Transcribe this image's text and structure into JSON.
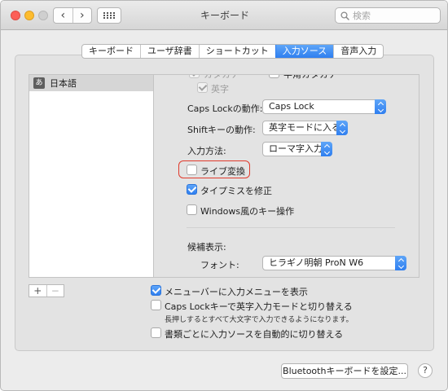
{
  "window": {
    "title": "キーボード"
  },
  "toolbar": {
    "back_glyph": "‹",
    "forward_glyph": "›",
    "show_all_icon": "grid-icon",
    "search_placeholder": "検索",
    "search_icon": "magnifier-icon"
  },
  "tabs": [
    {
      "label": "キーボード",
      "selected": false
    },
    {
      "label": "ユーザ辞書",
      "selected": false
    },
    {
      "label": "ショートカット",
      "selected": false
    },
    {
      "label": "入力ソース",
      "selected": true
    },
    {
      "label": "音声入力",
      "selected": false
    }
  ],
  "source_list": {
    "items": [
      {
        "icon_text": "あ",
        "label": "日本語",
        "selected": true
      }
    ],
    "add_label": "+",
    "remove_label": "−"
  },
  "input_source": {
    "partial_top": {
      "left_text": "カタカナ",
      "right_text": "半角カタカナ"
    },
    "eiji": {
      "label": "英字",
      "checked": true,
      "disabled": true
    },
    "caps_lock": {
      "label": "Caps Lockの動作:",
      "value": "Caps Lock"
    },
    "shift": {
      "label": "Shiftキーの動作:",
      "value": "英字モードに入る"
    },
    "input_method": {
      "label": "入力方法:",
      "value": "ローマ字入力"
    },
    "live_conversion": {
      "label": "ライブ変換",
      "checked": false
    },
    "typo_fix": {
      "label": "タイプミスを修正",
      "checked": true
    },
    "windows_keys": {
      "label": "Windows風のキー操作",
      "checked": false
    },
    "candidates": {
      "label": "候補表示:",
      "font_label": "フォント:",
      "font_value": "ヒラギノ明朝 ProN W6"
    }
  },
  "options": {
    "menu_bar": {
      "label": "メニューバーに入力メニューを表示",
      "checked": true
    },
    "caps_toggle": {
      "label": "Caps Lockキーで英字入力モードと切り替える",
      "checked": false,
      "note": "長押しするとすべて大文字で入力できるようになります。"
    },
    "auto_switch": {
      "label": "書類ごとに入力ソースを自動的に切り替える",
      "checked": false
    }
  },
  "footer": {
    "bluetooth_label": "Bluetoothキーボードを設定...",
    "help_label": "?"
  },
  "colors": {
    "accent": "#2f7ff0",
    "highlight_ring": "#e03a2c"
  }
}
